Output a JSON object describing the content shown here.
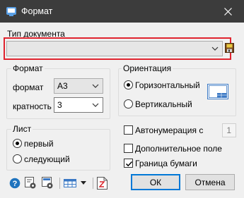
{
  "window": {
    "title": "Формат",
    "app_icon": "app-icon",
    "close_icon": "close-icon"
  },
  "doc_type": {
    "label": "Тип документа",
    "value": "",
    "save_icon": "floppy-save-icon"
  },
  "format_group": {
    "title": "Формат",
    "format_label": "формат",
    "format_value": "А3",
    "multiplicity_label": "кратность",
    "multiplicity_value": "3"
  },
  "orientation_group": {
    "title": "Ориентация",
    "horizontal_label": "Горизонтальный",
    "vertical_label": "Вертикальный",
    "selected": "horizontal"
  },
  "sheet_group": {
    "title": "Лист",
    "first_label": "первый",
    "next_label": "следующий",
    "selected": "first"
  },
  "options": {
    "autonumbering_label": "Автонумерация с",
    "autonumbering_checked": false,
    "autonumbering_value": "1",
    "extra_field_label": "Дополнительное поле",
    "extra_field_checked": false,
    "paper_border_label": "Граница бумаги",
    "paper_border_checked": true
  },
  "toolbar_icons": [
    "help-icon",
    "settings-icon",
    "sheet-settings-icon",
    "table-dropdown-icon",
    "document-icon"
  ],
  "buttons": {
    "ok_label": "ОК",
    "cancel_label": "Отмена"
  },
  "colors": {
    "title_bar": "#3c3c3c",
    "highlight_frame": "#e0242f",
    "default_button_border": "#0078d7",
    "help_icon": "#1e73be"
  }
}
